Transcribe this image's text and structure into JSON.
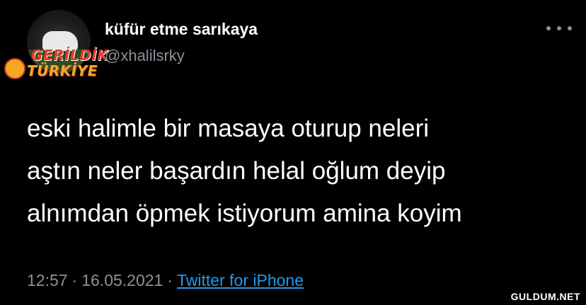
{
  "tweet": {
    "display_name": "küfür etme sarıkaya",
    "handle": "@xhalilsrky",
    "lines": [
      "eski halimle bir masaya oturup neleri",
      "aştın neler başardın helal oğlum deyip",
      "alnımdan öpmek istiyorum amina koyim"
    ],
    "time": "12:57",
    "separator": "·",
    "date": "16.05.2021",
    "source": "Twitter for iPhone"
  },
  "overlay": {
    "gerildik_line1": "GERİLDİK",
    "gerildik_line2": "TÜRKİYE",
    "site": "GULDUM.NET"
  },
  "colors": {
    "background": "#000000",
    "text": "#ffffff",
    "muted": "#8a9199",
    "link": "#1d9bf0",
    "logo_red": "#e23c2a",
    "logo_orange": "#f5a623"
  },
  "icons": {
    "more": "more-horizontal-icon"
  }
}
